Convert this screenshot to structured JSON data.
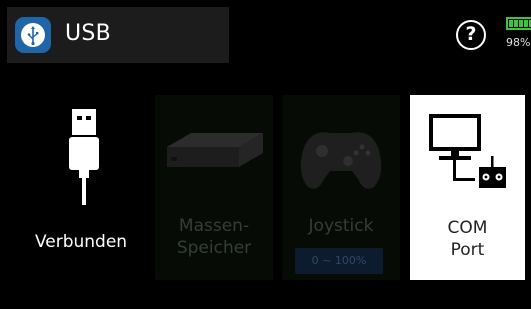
{
  "header": {
    "title": "USB",
    "help_glyph": "?",
    "battery": {
      "percent_label": "98%",
      "level": 0.98,
      "color": "#3cc43c"
    },
    "usb_icon": "usb-trident-icon",
    "badge_color": "#1f66a8"
  },
  "tiles": [
    {
      "label": "Verbunden",
      "icon": "usb-plug-icon",
      "selected": false,
      "enabled": true
    },
    {
      "label": "Massen-\nSpeicher",
      "icon": "external-drive-icon",
      "selected": false,
      "enabled": false
    },
    {
      "label": "Joystick",
      "icon": "gamepad-icon",
      "selected": false,
      "enabled": false,
      "range": "0 ~ 100%"
    },
    {
      "label": "COM\nPort",
      "icon": "monitor-transmitter-icon",
      "selected": true,
      "enabled": true
    }
  ]
}
